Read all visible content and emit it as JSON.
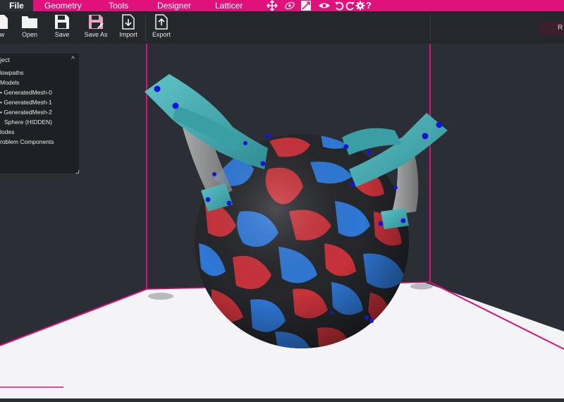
{
  "menu": {
    "file": "File",
    "geometry": "Geometry",
    "tools": "Tools",
    "designer": "Designer",
    "latticer": "Latticer"
  },
  "toolbar": {
    "new_label": "w",
    "open_label": "Open",
    "save_label": "Save",
    "saveas_label": "Save As",
    "import_label": "Import",
    "export_label": "Export",
    "right_button_label": "R"
  },
  "panel": {
    "title": "ject",
    "items": [
      {
        "label": "lowpaths"
      },
      {
        "label": "Models"
      },
      {
        "label": "GeneratedMesh-0"
      },
      {
        "label": "GeneratedMesh-1"
      },
      {
        "label": "GeneratedMesh-2"
      },
      {
        "label": "Sphere (HIDDEN)"
      },
      {
        "label": "lodes"
      },
      {
        "label": "roblem Components"
      }
    ]
  },
  "icons": {
    "move": "move-icon",
    "orbit": "orbit-icon",
    "scale": "scale-icon",
    "view": "eye-icon",
    "undo": "undo-icon",
    "redo": "redo-icon",
    "settings": "gear-icon",
    "help": "help-icon"
  },
  "colors": {
    "accent": "#e0117a",
    "sphere_blue": "#2f78d6",
    "sphere_red": "#c8323a",
    "sphere_dark": "#26272b",
    "tube_teal": "#4db0b5"
  }
}
